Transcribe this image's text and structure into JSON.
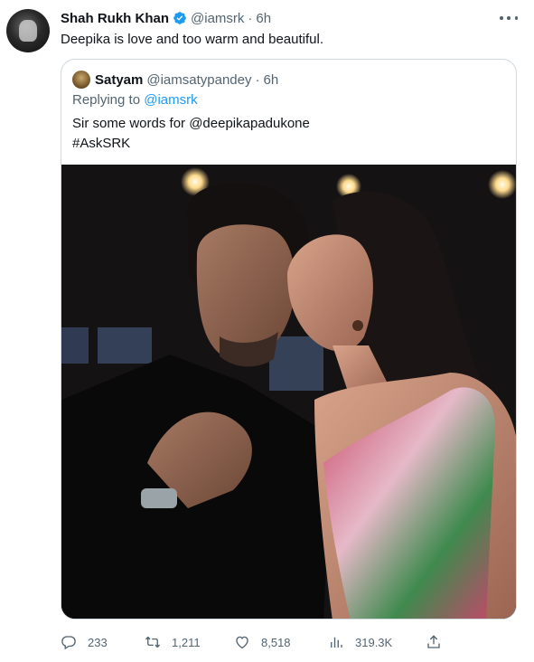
{
  "tweet": {
    "author_name": "Shah Rukh Khan",
    "handle": "@iamsrk",
    "dot": "·",
    "time": "6h",
    "text": "Deepika is love and too warm and beautiful."
  },
  "quoted_tweet": {
    "author_name": "Satyam",
    "handle": "@iamsatypandey",
    "dot": "·",
    "time": "6h",
    "replying_prefix": "Replying to ",
    "replying_to": "@iamsrk",
    "line1_prefix": "Sir some words for ",
    "line1_mention": "@deepikapadukone",
    "hashtag": "#AskSRK"
  },
  "actions": {
    "replies": "233",
    "retweets": "1,211",
    "likes": "8,518",
    "views": "319.3K"
  },
  "colors": {
    "accent": "#1d9bf0",
    "secondary_text": "#536471",
    "border": "#cfd9de"
  },
  "icons": [
    "verified-badge-icon",
    "more-icon",
    "reply-icon",
    "retweet-icon",
    "like-icon",
    "views-icon",
    "share-icon"
  ]
}
